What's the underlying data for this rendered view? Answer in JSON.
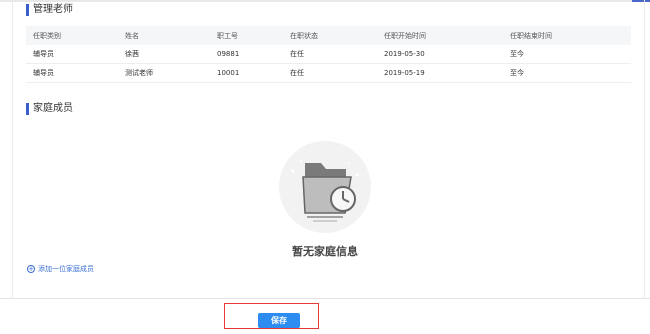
{
  "teachers_section": {
    "title": "管理老师",
    "columns": [
      "任职类别",
      "姓名",
      "职工号",
      "在职状态",
      "任职开始时间",
      "任职结束时间"
    ],
    "rows": [
      [
        "辅导员",
        "徐茜",
        "09881",
        "在任",
        "2019-05-30",
        "至今"
      ],
      [
        "辅导员",
        "测试老师",
        "10001",
        "在任",
        "2019-05-19",
        "至今"
      ]
    ]
  },
  "family_section": {
    "title": "家庭成员",
    "empty_text": "暂无家庭信息",
    "empty_icon": "empty-folder-clock-icon",
    "add_label": "添加一位家庭成员"
  },
  "footer": {
    "save_label": "保存"
  },
  "colors": {
    "accent": "#3a5fcd",
    "link": "#3a6fd6",
    "button": "#2d8cf0",
    "highlight_box": "#e53935"
  }
}
